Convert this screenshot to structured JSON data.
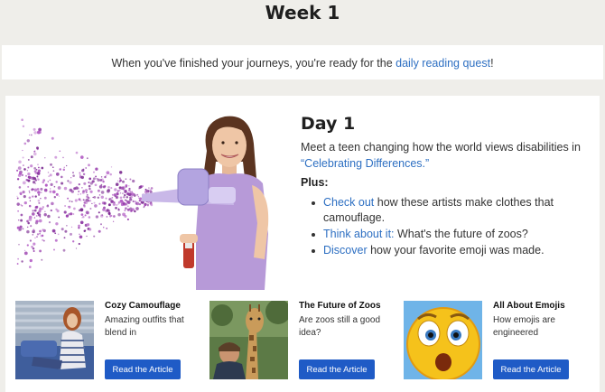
{
  "page": {
    "title": "Week 1"
  },
  "banner": {
    "text": "When you've finished your journeys, you're ready for the ",
    "link": "daily reading quest",
    "suffix": "!"
  },
  "day": {
    "title": "Day 1",
    "desc_text": "Meet a teen changing how the world views disabilities in ",
    "desc_link": "“Celebrating Differences.”",
    "plus_label": "Plus:",
    "items": [
      {
        "link": "Check out",
        "text": " how these artists make clothes that camouflage."
      },
      {
        "link": "Think about it:",
        "text": " What's the future of zoos?"
      },
      {
        "link": "Discover",
        "text": " how your favorite emoji was made."
      }
    ]
  },
  "articles": [
    {
      "title": "Cozy Camouflage",
      "desc": "Amazing outfits that blend in",
      "button": "Read the Article",
      "image": "woman-in-striped-sweater-on-couch"
    },
    {
      "title": "The Future of Zoos",
      "desc": "Are zoos still a good idea?",
      "button": "Read the Article",
      "image": "boy-looking-at-giraffe"
    },
    {
      "title": "All About Emojis",
      "desc": "How emojis are engineered",
      "button": "Read the Article",
      "image": "surprised-emoji-face"
    }
  ],
  "colors": {
    "link": "#2d6fc2",
    "button": "#1f5bc6",
    "spray": "#9a3fae",
    "shirt": "#b79ad8"
  }
}
